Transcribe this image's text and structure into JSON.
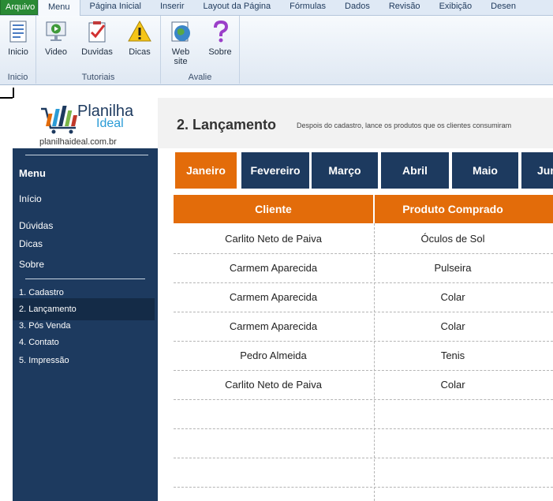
{
  "ribbon": {
    "tabs": [
      "Arquivo",
      "Menu",
      "Página Inicial",
      "Inserir",
      "Layout da Página",
      "Fórmulas",
      "Dados",
      "Revisão",
      "Exibição",
      "Desen"
    ],
    "groups": {
      "inicio": {
        "label": "Inicio",
        "buttons": [
          "Inicio"
        ]
      },
      "tutoriais": {
        "label": "Tutoriais",
        "buttons": [
          "Video",
          "Duvidas",
          "Dicas"
        ]
      },
      "avalie": {
        "label": "Avalie",
        "buttons": [
          "Web site",
          "Sobre"
        ]
      }
    }
  },
  "logo": {
    "line1": "Planilha",
    "line2": "Ideal",
    "url": "planilhaideal.com.br"
  },
  "sidebar": {
    "title": "Menu",
    "items": [
      "Início",
      "Dúvidas",
      "Dicas",
      "Sobre"
    ],
    "sub_items": [
      "1. Cadastro",
      "2. Lançamento",
      "3. Pós Venda",
      "4. Contato",
      "5. Impressão"
    ],
    "active_sub": "2. Lançamento"
  },
  "header": {
    "title": "2. Lançamento",
    "subtitle": "Despois do cadastro, lance os produtos que os clientes consumiram"
  },
  "months": [
    "Janeiro",
    "Fevereiro",
    "Março",
    "Abril",
    "Maio",
    "Jun"
  ],
  "active_month": "Janeiro",
  "table": {
    "headers": [
      "Cliente",
      "Produto Comprado"
    ],
    "rows": [
      [
        "Carlito Neto de Paiva",
        "Óculos de Sol"
      ],
      [
        "Carmem Aparecida",
        "Pulseira"
      ],
      [
        "Carmem Aparecida",
        "Colar"
      ],
      [
        "Carmem Aparecida",
        "Colar"
      ],
      [
        "Pedro Almeida",
        "Tenis"
      ],
      [
        "Carlito Neto de Paiva",
        "Colar"
      ]
    ]
  },
  "colors": {
    "navy": "#1d3a5f",
    "orange": "#e36c0a",
    "file_tab": "#2a8a35"
  }
}
